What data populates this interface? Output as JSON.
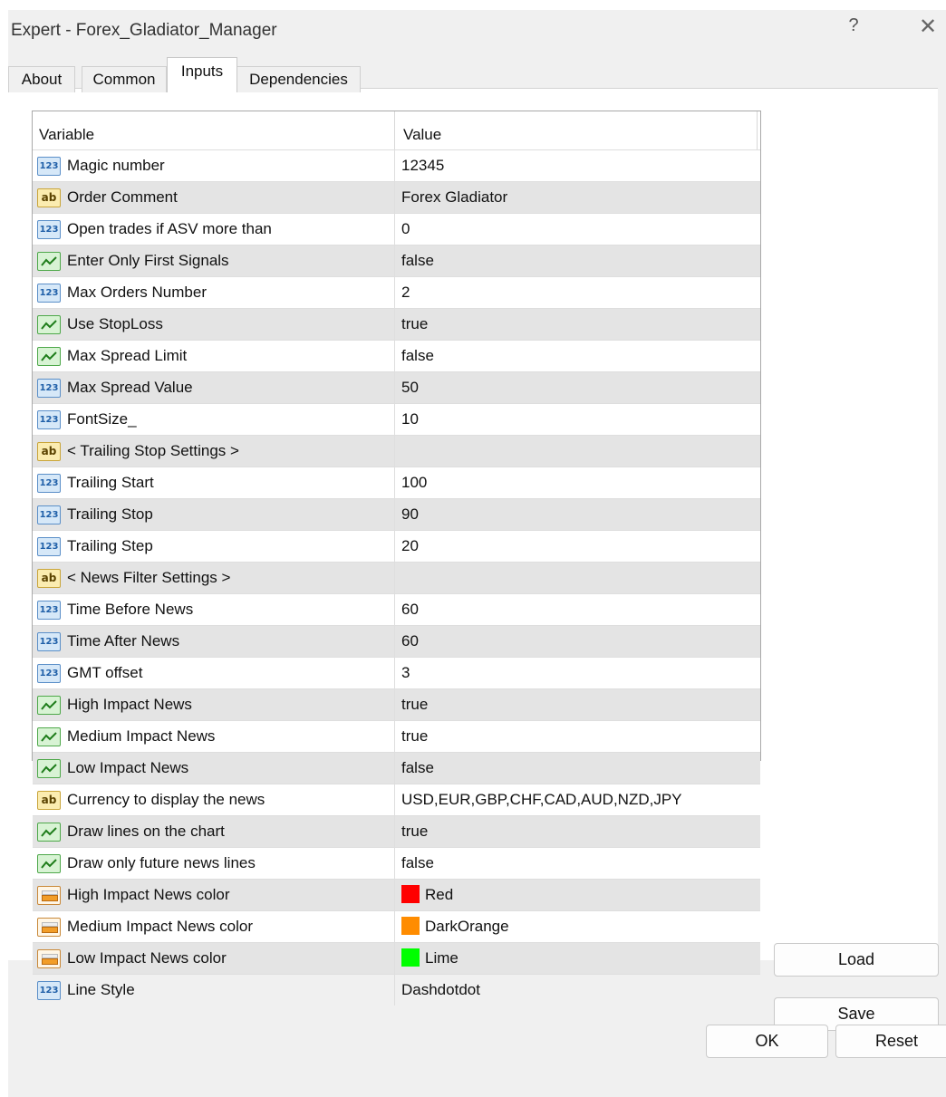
{
  "window": {
    "title": "Expert - Forex_Gladiator_Manager",
    "help_label": "?",
    "close_label": "✕"
  },
  "tabs": [
    {
      "label": "About"
    },
    {
      "label": "Common"
    },
    {
      "label": "Inputs",
      "active": true
    },
    {
      "label": "Dependencies"
    }
  ],
  "grid": {
    "header_variable": "Variable",
    "header_value": "Value",
    "rows": [
      {
        "type": "num",
        "name": "Magic number",
        "value": "12345"
      },
      {
        "type": "str",
        "name": "Order Comment",
        "value": "Forex Gladiator"
      },
      {
        "type": "num",
        "name": "Open trades if ASV more than",
        "value": "0"
      },
      {
        "type": "bool",
        "name": "Enter Only First Signals",
        "value": "false"
      },
      {
        "type": "num",
        "name": "Max Orders Number",
        "value": "2"
      },
      {
        "type": "bool",
        "name": "Use StopLoss",
        "value": "true"
      },
      {
        "type": "bool",
        "name": "Max Spread Limit",
        "value": "false"
      },
      {
        "type": "num",
        "name": "Max Spread Value",
        "value": "50"
      },
      {
        "type": "num",
        "name": "FontSize_",
        "value": "10"
      },
      {
        "type": "str",
        "name": "< Trailing Stop Settings >",
        "value": ""
      },
      {
        "type": "num",
        "name": "Trailing Start",
        "value": "100"
      },
      {
        "type": "num",
        "name": "Trailing Stop",
        "value": "90"
      },
      {
        "type": "num",
        "name": "Trailing Step",
        "value": "20"
      },
      {
        "type": "str",
        "name": "< News Filter Settings >",
        "value": ""
      },
      {
        "type": "num",
        "name": "Time Before News",
        "value": "60"
      },
      {
        "type": "num",
        "name": "Time After News",
        "value": "60"
      },
      {
        "type": "num",
        "name": "GMT offset",
        "value": "3"
      },
      {
        "type": "bool",
        "name": "High Impact News",
        "value": "true"
      },
      {
        "type": "bool",
        "name": "Medium Impact News",
        "value": "true"
      },
      {
        "type": "bool",
        "name": "Low Impact News",
        "value": "false"
      },
      {
        "type": "str",
        "name": "Currency to display the news",
        "value": "USD,EUR,GBP,CHF,CAD,AUD,NZD,JPY"
      },
      {
        "type": "bool",
        "name": "Draw lines on the chart",
        "value": "true"
      },
      {
        "type": "bool",
        "name": "Draw only future news lines",
        "value": "false"
      },
      {
        "type": "color",
        "name": "High Impact News color",
        "value": "Red",
        "swatch": "#ff0000"
      },
      {
        "type": "color",
        "name": "Medium Impact News color",
        "value": "DarkOrange",
        "swatch": "#ff8c00"
      },
      {
        "type": "color",
        "name": "Low Impact News color",
        "value": "Lime",
        "swatch": "#00ff00"
      },
      {
        "type": "num",
        "name": "Line Style",
        "value": "Dashdotdot"
      }
    ]
  },
  "icons": {
    "num": "123",
    "str": "ab"
  },
  "buttons": {
    "load": "Load",
    "save": "Save",
    "ok": "OK",
    "reset": "Reset"
  }
}
